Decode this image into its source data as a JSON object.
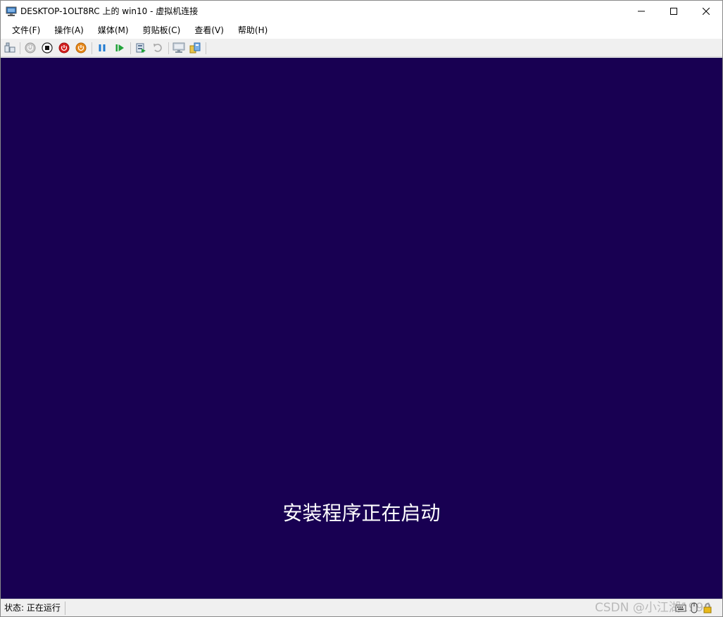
{
  "window": {
    "title": "DESKTOP-1OLT8RC 上的 win10 - 虚拟机连接",
    "icon": "vm-connection-icon",
    "controls": [
      "minimize-icon",
      "maximize-icon",
      "close-icon"
    ]
  },
  "menu": {
    "items": [
      {
        "label": "文件(F)"
      },
      {
        "label": "操作(A)"
      },
      {
        "label": "媒体(M)"
      },
      {
        "label": "剪贴板(C)"
      },
      {
        "label": "查看(V)"
      },
      {
        "label": "帮助(H)"
      }
    ]
  },
  "toolbar": {
    "buttons": [
      {
        "name": "ctrl-alt-del-icon"
      },
      {
        "name": "start-icon"
      },
      {
        "name": "turn-off-icon"
      },
      {
        "name": "shut-down-icon"
      },
      {
        "name": "save-icon"
      },
      {
        "name": "pause-icon"
      },
      {
        "name": "resume-icon"
      },
      {
        "name": "checkpoint-icon"
      },
      {
        "name": "revert-icon"
      },
      {
        "name": "enhanced-session-icon"
      },
      {
        "name": "share-icon"
      }
    ]
  },
  "screen": {
    "message": "安装程序正在启动",
    "background_color": "#180052"
  },
  "statusbar": {
    "status": "状态: 正在运行",
    "icons": [
      "keyboard-icon",
      "mouse-icon",
      "lock-icon"
    ]
  },
  "watermark": {
    "text": "CSDN @小江湖1994"
  }
}
